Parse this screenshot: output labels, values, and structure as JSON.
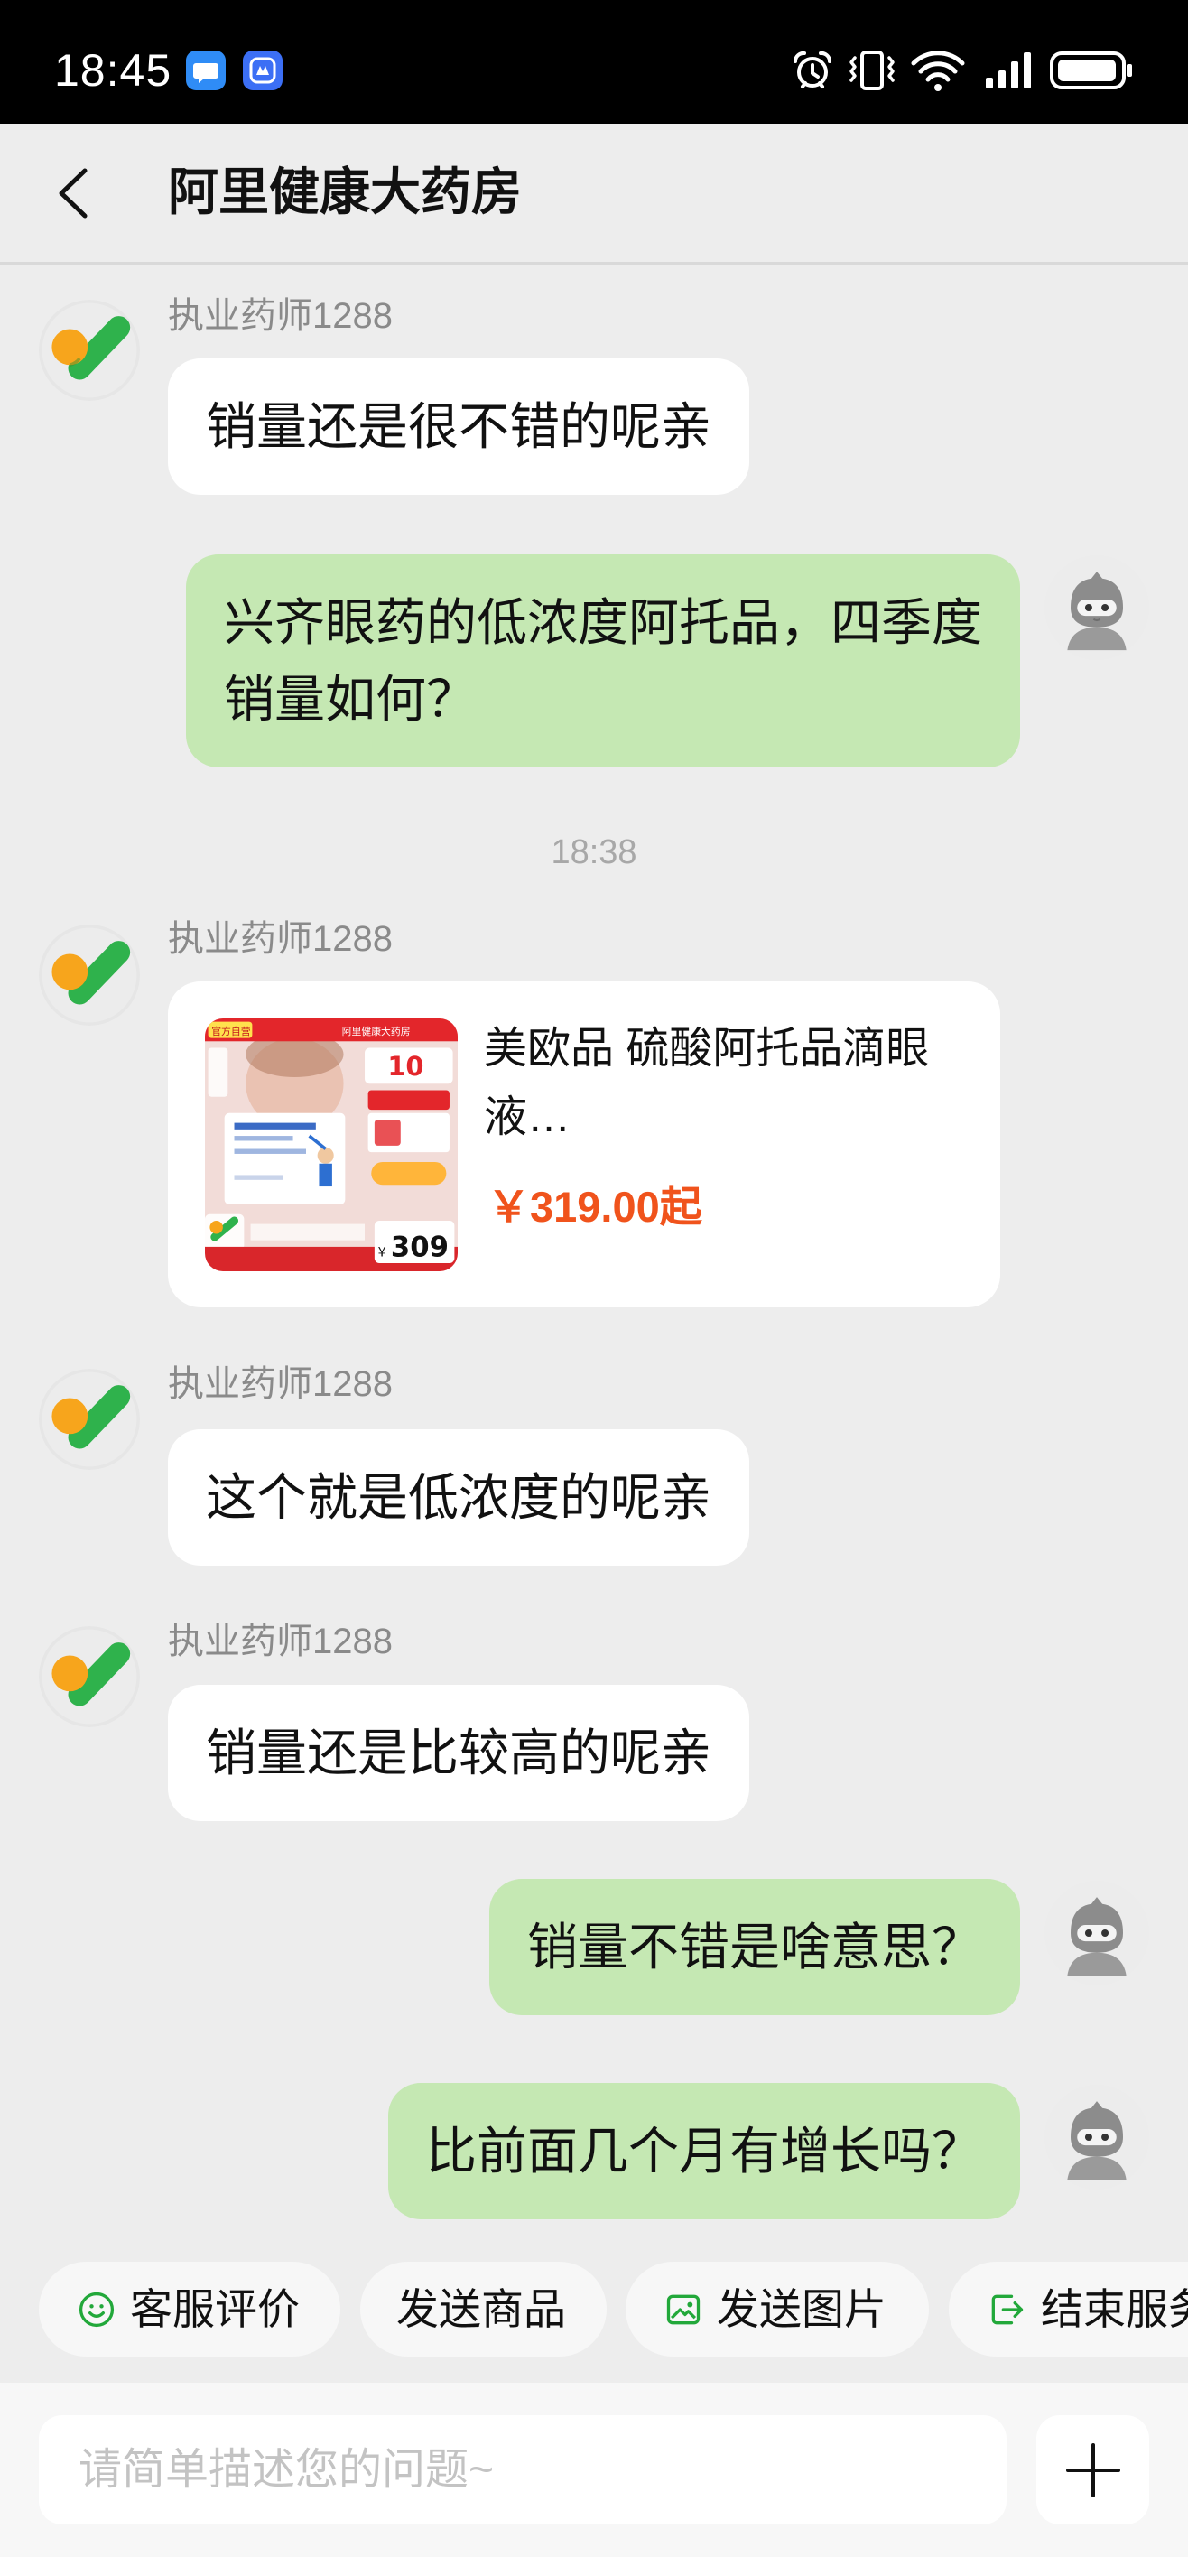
{
  "status_bar": {
    "time": "18:45",
    "notification_icons": [
      "chat-app-icon",
      "assistant-app-icon"
    ],
    "system_icons": [
      "alarm-icon",
      "vibrate-icon",
      "wifi-icon",
      "signal-icon",
      "battery-icon"
    ]
  },
  "header": {
    "back_icon": "chevron-left-icon",
    "title": "阿里健康大药房"
  },
  "conversation": {
    "timestamp": "18:38",
    "messages": [
      {
        "from": "pharmacist",
        "sender": "执业药师1288",
        "lines": [
          "销量还是很不错的呢亲"
        ]
      },
      {
        "from": "user",
        "lines": [
          "兴齐眼药的低浓度阿托品，四季度",
          "销量如何？"
        ]
      },
      {
        "from": "pharmacist",
        "sender": "执业药师1288",
        "type": "product_card",
        "product": {
          "title_lines": [
            "美欧品 硫酸阿托品滴眼",
            "液…"
          ],
          "price": "￥319.00起",
          "image": {
            "badge": "官方自营",
            "store": "阿里健康大药房",
            "price_tag": "309"
          }
        }
      },
      {
        "from": "pharmacist",
        "sender": "执业药师1288",
        "lines": [
          "这个就是低浓度的呢亲"
        ]
      },
      {
        "from": "pharmacist",
        "sender": "执业药师1288",
        "lines": [
          "销量还是比较高的呢亲"
        ]
      },
      {
        "from": "user",
        "lines": [
          "销量不错是啥意思？"
        ]
      },
      {
        "from": "user",
        "lines": [
          "比前面几个月有增长吗？"
        ]
      }
    ]
  },
  "quick_actions": [
    {
      "label": "客服评价",
      "icon": "smile-icon"
    },
    {
      "label": "发送商品",
      "icon": ""
    },
    {
      "label": "发送图片",
      "icon": "image-icon"
    },
    {
      "label": "结束服务",
      "icon": "exit-icon"
    }
  ],
  "composer": {
    "placeholder": "请简单描述您的问题~",
    "plus_icon": "plus-icon"
  },
  "colors": {
    "status_bar": "#000000",
    "chat_background": "#ededed",
    "pharmacist_bubble": "#ffffff",
    "user_bubble": "#c5e8b3",
    "price": "#f0531c",
    "accent_green": "#22a83a"
  }
}
